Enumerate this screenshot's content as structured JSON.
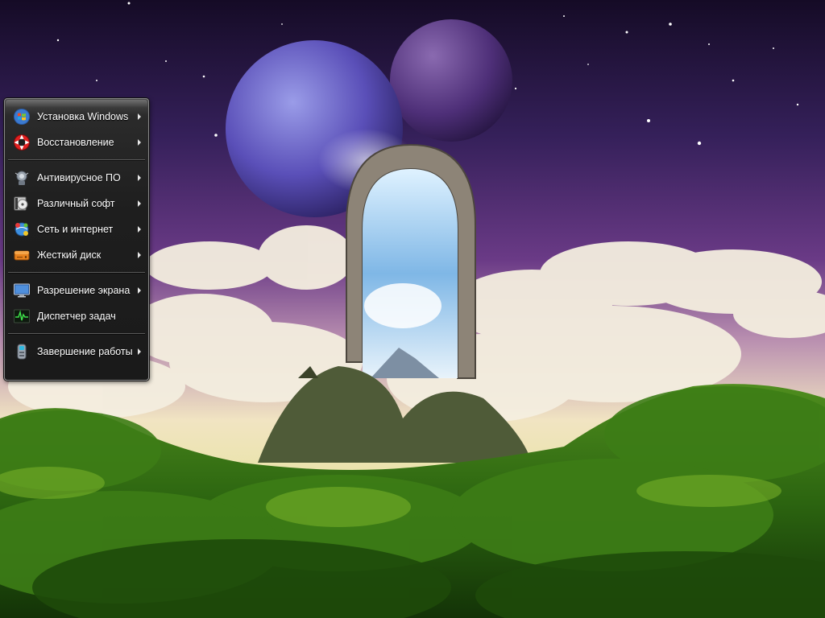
{
  "menu": {
    "items": [
      {
        "label": "Установка Windows",
        "icon": "windows-logo-icon"
      },
      {
        "label": "Восстановление",
        "icon": "lifebuoy-icon"
      },
      {
        "label": "Антивирусное ПО",
        "icon": "antivirus-icon"
      },
      {
        "label": "Различный софт",
        "icon": "software-icon"
      },
      {
        "label": "Сеть и интернет",
        "icon": "network-icon"
      },
      {
        "label": "Жесткий диск",
        "icon": "hard-disk-icon"
      },
      {
        "label": "Разрешение экрана",
        "icon": "monitor-icon"
      },
      {
        "label": "Диспетчер задач",
        "icon": "task-manager-icon"
      },
      {
        "label": "Завершение работы",
        "icon": "shutdown-icon"
      }
    ]
  },
  "colors": {
    "menu_background": "#1e1e1e",
    "menu_border": "#8a8a8a",
    "menu_text": "#ffffff",
    "sky_top": "#1c0f33",
    "sky_purple": "#5a2f86",
    "ground_green": "#2f6b12"
  }
}
